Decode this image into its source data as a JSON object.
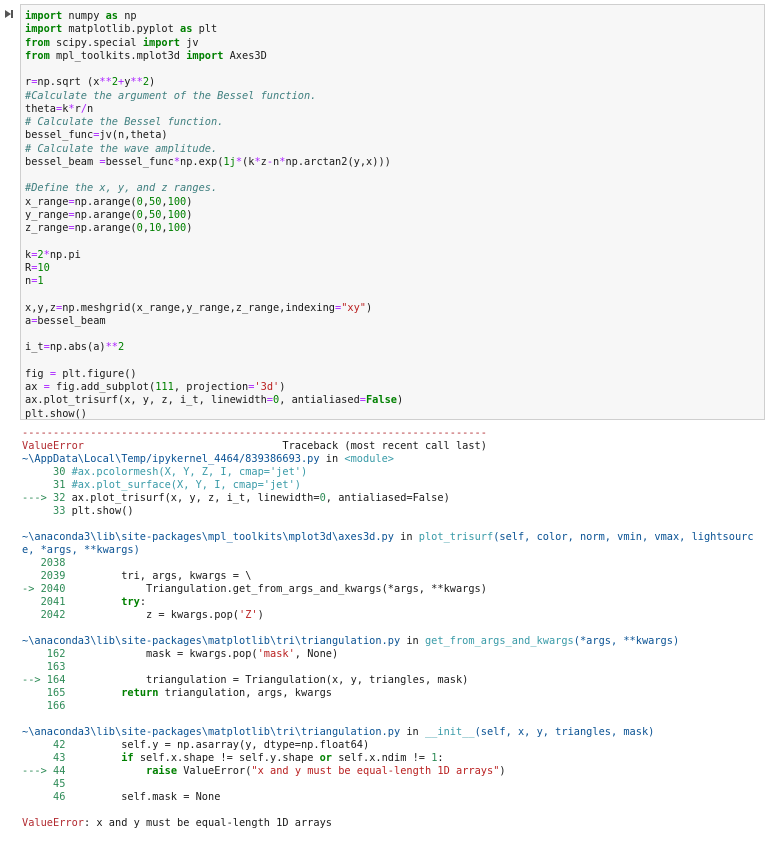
{
  "run_icon": "run-cell-icon",
  "code_lines": [
    [
      [
        "import",
        "kw"
      ],
      [
        " numpy ",
        ""
      ],
      [
        "as",
        "kw"
      ],
      [
        " np",
        ""
      ]
    ],
    [
      [
        "import",
        "kw"
      ],
      [
        " matplotlib.pyplot ",
        ""
      ],
      [
        "as",
        "kw"
      ],
      [
        " plt",
        ""
      ]
    ],
    [
      [
        "from",
        "kw"
      ],
      [
        " scipy.special ",
        ""
      ],
      [
        "import",
        "kw"
      ],
      [
        " jv",
        ""
      ]
    ],
    [
      [
        "from",
        "kw"
      ],
      [
        " mpl_toolkits.mplot3d ",
        ""
      ],
      [
        "import",
        "kw"
      ],
      [
        " Axes3D",
        ""
      ]
    ],
    [],
    [
      [
        "r",
        ""
      ],
      [
        "=",
        "op"
      ],
      [
        "np.sqrt (x",
        ""
      ],
      [
        "**",
        "op"
      ],
      [
        "2",
        "num"
      ],
      [
        "+",
        "op"
      ],
      [
        "y",
        ""
      ],
      [
        "**",
        "op"
      ],
      [
        "2",
        "num"
      ],
      [
        ")",
        ""
      ]
    ],
    [
      [
        "#Calculate the argument of the Bessel function.",
        "cm"
      ]
    ],
    [
      [
        "theta",
        ""
      ],
      [
        "=",
        "op"
      ],
      [
        "k",
        ""
      ],
      [
        "*",
        "op"
      ],
      [
        "r",
        ""
      ],
      [
        "/",
        "op"
      ],
      [
        "n",
        ""
      ]
    ],
    [
      [
        "# Calculate the Bessel function.",
        "cm"
      ]
    ],
    [
      [
        "bessel_func",
        ""
      ],
      [
        "=",
        "op"
      ],
      [
        "jv(n,theta)",
        ""
      ]
    ],
    [
      [
        "# Calculate the wave amplitude.",
        "cm"
      ]
    ],
    [
      [
        "bessel_beam ",
        ""
      ],
      [
        "=",
        "op"
      ],
      [
        "bessel_func",
        ""
      ],
      [
        "*",
        "op"
      ],
      [
        "np.exp(",
        ""
      ],
      [
        "1j",
        "num"
      ],
      [
        "*",
        "op"
      ],
      [
        "(k",
        ""
      ],
      [
        "*",
        "op"
      ],
      [
        "z",
        ""
      ],
      [
        "-",
        "op"
      ],
      [
        "n",
        ""
      ],
      [
        "*",
        "op"
      ],
      [
        "np.arctan2(y,x)))",
        ""
      ]
    ],
    [],
    [
      [
        "#Define the x, y, and z ranges.",
        "cm"
      ]
    ],
    [
      [
        "x_range",
        ""
      ],
      [
        "=",
        "op"
      ],
      [
        "np.arange(",
        ""
      ],
      [
        "0",
        "num"
      ],
      [
        ",",
        ""
      ],
      [
        "50",
        "num"
      ],
      [
        ",",
        ""
      ],
      [
        "100",
        "num"
      ],
      [
        ")",
        ""
      ]
    ],
    [
      [
        "y_range",
        ""
      ],
      [
        "=",
        "op"
      ],
      [
        "np.arange(",
        ""
      ],
      [
        "0",
        "num"
      ],
      [
        ",",
        ""
      ],
      [
        "50",
        "num"
      ],
      [
        ",",
        ""
      ],
      [
        "100",
        "num"
      ],
      [
        ")",
        ""
      ]
    ],
    [
      [
        "z_range",
        ""
      ],
      [
        "=",
        "op"
      ],
      [
        "np.arange(",
        ""
      ],
      [
        "0",
        "num"
      ],
      [
        ",",
        ""
      ],
      [
        "10",
        "num"
      ],
      [
        ",",
        ""
      ],
      [
        "100",
        "num"
      ],
      [
        ")",
        ""
      ]
    ],
    [],
    [
      [
        "k",
        ""
      ],
      [
        "=",
        "op"
      ],
      [
        "2",
        "num"
      ],
      [
        "*",
        "op"
      ],
      [
        "np.pi",
        ""
      ]
    ],
    [
      [
        "R",
        ""
      ],
      [
        "=",
        "op"
      ],
      [
        "10",
        "num"
      ]
    ],
    [
      [
        "n",
        ""
      ],
      [
        "=",
        "op"
      ],
      [
        "1",
        "num"
      ]
    ],
    [],
    [
      [
        "x,y,z",
        ""
      ],
      [
        "=",
        "op"
      ],
      [
        "np.meshgrid(x_range,y_range,z_range,indexing",
        ""
      ],
      [
        "=",
        "op"
      ],
      [
        "\"xy\"",
        "str"
      ],
      [
        ")",
        ""
      ]
    ],
    [
      [
        "a",
        ""
      ],
      [
        "=",
        "op"
      ],
      [
        "bessel_beam",
        ""
      ]
    ],
    [],
    [
      [
        "i_t",
        ""
      ],
      [
        "=",
        "op"
      ],
      [
        "np.abs(a)",
        ""
      ],
      [
        "**",
        "op"
      ],
      [
        "2",
        "num"
      ]
    ],
    [],
    [
      [
        "fig ",
        ""
      ],
      [
        "=",
        "op"
      ],
      [
        " plt.figure()",
        ""
      ]
    ],
    [
      [
        "ax ",
        ""
      ],
      [
        "=",
        "op"
      ],
      [
        " fig.add_subplot(",
        ""
      ],
      [
        "111",
        "num"
      ],
      [
        ", projection",
        ""
      ],
      [
        "=",
        "op"
      ],
      [
        "'3d'",
        "str"
      ],
      [
        ")",
        ""
      ]
    ],
    [
      [
        "ax.plot_trisurf(x, y, z, i_t, linewidth",
        ""
      ],
      [
        "=",
        "op"
      ],
      [
        "0",
        "num"
      ],
      [
        ", antialiased",
        ""
      ],
      [
        "=",
        "op"
      ],
      [
        "False",
        "kw"
      ],
      [
        ")",
        ""
      ]
    ],
    [
      [
        "plt.show()",
        ""
      ]
    ]
  ],
  "output_lines": [
    {
      "cls": "dash",
      "parts": [
        [
          "---------------------------------------------------------------------------",
          "err-red"
        ]
      ]
    },
    {
      "parts": [
        [
          "ValueError",
          "err-red"
        ],
        [
          "                                Traceback (most recent call last)",
          ""
        ]
      ]
    },
    {
      "parts": [
        [
          "~\\AppData\\Local\\Temp/ipykernel_4464/839386693.py",
          "path"
        ],
        [
          " in ",
          ""
        ],
        [
          "<module>",
          "link"
        ]
      ]
    },
    {
      "parts": [
        [
          "     30 ",
          "lno"
        ],
        [
          "#ax.pcolormesh(X, Y, Z, I, cmap='jet')",
          "fn"
        ]
      ]
    },
    {
      "parts": [
        [
          "     31 ",
          "lno"
        ],
        [
          "#ax.plot_surface(X, Y, I, cmap='jet')",
          "fn"
        ]
      ]
    },
    {
      "parts": [
        [
          "---> 32 ",
          "arrow"
        ],
        [
          "ax.plot_trisurf(x, y, z, i_t, linewidth=",
          ""
        ],
        [
          "0",
          "lno"
        ],
        [
          ", antialiased=False)",
          ""
        ]
      ]
    },
    {
      "parts": [
        [
          "     33 ",
          "lno"
        ],
        [
          "plt.show()",
          ""
        ]
      ]
    },
    {
      "gap": true
    },
    {
      "cls": "wrap",
      "parts": [
        [
          "~\\anaconda3\\lib\\site-packages\\mpl_toolkits\\mplot3d\\axes3d.py",
          "path"
        ],
        [
          " in ",
          ""
        ],
        [
          "plot_trisurf",
          "fn"
        ],
        [
          "(self, color, norm, vmin, vmax, lightsource, *args, **kwargs)",
          "args"
        ]
      ]
    },
    {
      "parts": [
        [
          "   2038",
          "lno"
        ]
      ]
    },
    {
      "parts": [
        [
          "   2039 ",
          "lno"
        ],
        [
          "        tri, args, kwargs = \\",
          ""
        ]
      ]
    },
    {
      "parts": [
        [
          "-> 2040 ",
          "arrow"
        ],
        [
          "            Triangulation.get_from_args_and_kwargs(*args, **kwargs)",
          ""
        ]
      ]
    },
    {
      "parts": [
        [
          "   2041 ",
          "lno"
        ],
        [
          "        ",
          ""
        ],
        [
          "try",
          "kw"
        ],
        [
          ":",
          ""
        ]
      ]
    },
    {
      "parts": [
        [
          "   2042 ",
          "lno"
        ],
        [
          "            z = kwargs.pop(",
          ""
        ],
        [
          "'Z'",
          "str"
        ],
        [
          ")",
          ""
        ]
      ]
    },
    {
      "gap": true
    },
    {
      "parts": [
        [
          "~\\anaconda3\\lib\\site-packages\\matplotlib\\tri\\triangulation.py",
          "path"
        ],
        [
          " in ",
          ""
        ],
        [
          "get_from_args_and_kwargs",
          "fn"
        ],
        [
          "(*args, **kwargs)",
          "args"
        ]
      ]
    },
    {
      "parts": [
        [
          "    162 ",
          "lno"
        ],
        [
          "            mask = kwargs.pop(",
          ""
        ],
        [
          "'mask'",
          "str"
        ],
        [
          ", None)",
          ""
        ]
      ]
    },
    {
      "parts": [
        [
          "    163",
          "lno"
        ]
      ]
    },
    {
      "parts": [
        [
          "--> 164 ",
          "arrow"
        ],
        [
          "            triangulation = Triangulation(x, y, triangles, mask)",
          ""
        ]
      ]
    },
    {
      "parts": [
        [
          "    165 ",
          "lno"
        ],
        [
          "        ",
          ""
        ],
        [
          "return",
          "kw"
        ],
        [
          " triangulation, args, kwargs",
          ""
        ]
      ]
    },
    {
      "parts": [
        [
          "    166",
          "lno"
        ]
      ]
    },
    {
      "gap": true
    },
    {
      "parts": [
        [
          "~\\anaconda3\\lib\\site-packages\\matplotlib\\tri\\triangulation.py",
          "path"
        ],
        [
          " in ",
          ""
        ],
        [
          "__init__",
          "fn"
        ],
        [
          "(self, x, y, triangles, mask)",
          "args"
        ]
      ]
    },
    {
      "parts": [
        [
          "     42 ",
          "lno"
        ],
        [
          "        self.y = np.asarray(y, dtype=np.float64)",
          ""
        ]
      ]
    },
    {
      "parts": [
        [
          "     43 ",
          "lno"
        ],
        [
          "        ",
          ""
        ],
        [
          "if",
          "kw"
        ],
        [
          " self.x.shape != self.y.shape ",
          ""
        ],
        [
          "or",
          "kw"
        ],
        [
          " self.x.ndim != ",
          ""
        ],
        [
          "1",
          "lno"
        ],
        [
          ":",
          ""
        ]
      ]
    },
    {
      "parts": [
        [
          "---> 44 ",
          "arrow"
        ],
        [
          "            ",
          ""
        ],
        [
          "raise",
          "kw"
        ],
        [
          " ValueError(",
          ""
        ],
        [
          "\"x and y must be equal-length 1D arrays\"",
          "str"
        ],
        [
          ")",
          ""
        ]
      ]
    },
    {
      "parts": [
        [
          "     45",
          "lno"
        ]
      ]
    },
    {
      "parts": [
        [
          "     46 ",
          "lno"
        ],
        [
          "        self.mask = None",
          ""
        ]
      ]
    },
    {
      "gap": true
    },
    {
      "parts": [
        [
          "ValueError",
          "err-red"
        ],
        [
          ": x and y must be equal-length 1D arrays",
          ""
        ]
      ]
    }
  ]
}
